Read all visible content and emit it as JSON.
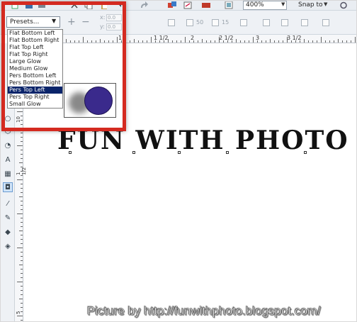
{
  "toolbar": {
    "zoom_value": "400%",
    "snap_label": "Snap to",
    "icons": [
      "new-doc-icon",
      "save-icon",
      "print-icon",
      "cut-icon",
      "copy-icon",
      "paste-icon",
      "undo-icon",
      "redo-icon",
      "import-icon",
      "export-icon",
      "app-launcher-icon",
      "welcome-icon"
    ]
  },
  "propbar": {
    "presets_label": "Presets...",
    "add_symbol": "+",
    "remove_symbol": "−",
    "x_label": "x:",
    "y_label": "y:",
    "x_value": "0.0",
    "y_value": "0.0",
    "opacity_value": "50",
    "feather_value": "15"
  },
  "presets": {
    "items": [
      "Flat Bottom Left",
      "Flat Bottom Right",
      "Flat Top Left",
      "Flat Top Right",
      "Large Glow",
      "Medium Glow",
      "Pers Bottom Left",
      "Pers Bottom Right",
      "Pers Top Left",
      "Pers Top Right",
      "Small Glow"
    ],
    "selected_index": 8
  },
  "ruler": {
    "h_labels": [
      "1",
      "1 1/2",
      "2",
      "2 1/2",
      "3",
      "3 1/2"
    ],
    "v_labels": [
      "10",
      "1 1/2",
      "5",
      "5 1/2"
    ]
  },
  "canvas": {
    "main_text": "FUN WITH PHOTO"
  },
  "preview": {
    "circle_color": "#3a2a8c",
    "shadow_color": "#6c6c6c"
  },
  "highlight_color": "#d42a20",
  "watermark": "Picture by http://funwithphoto.blogspot.com/"
}
